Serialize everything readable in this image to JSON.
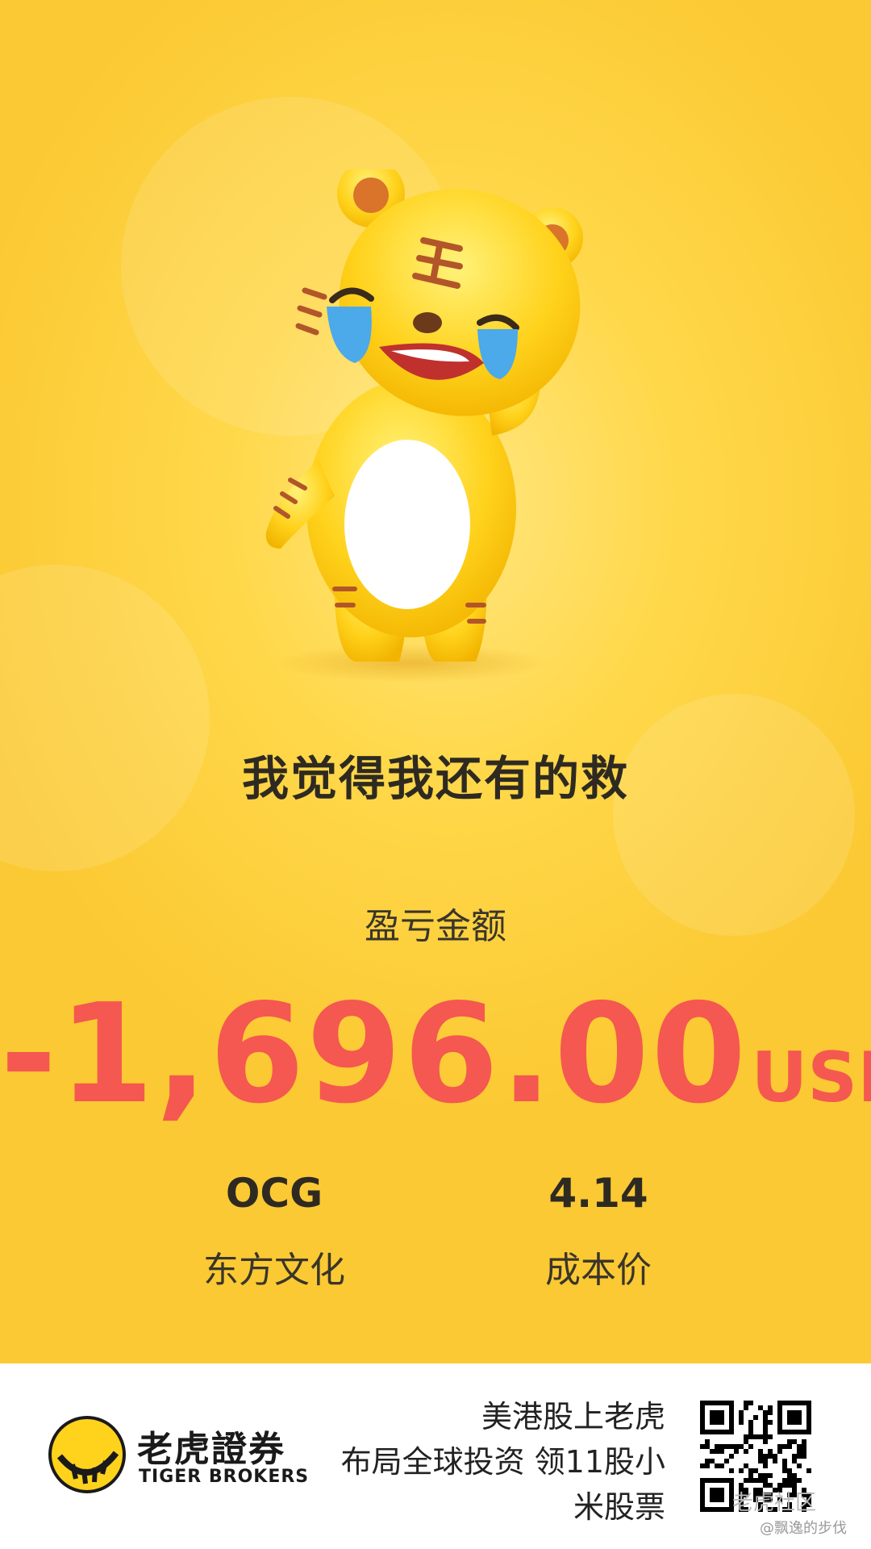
{
  "headline": "我觉得我还有的救",
  "pnl": {
    "label": "盈亏金额",
    "amount": "-1,696.00",
    "currency": "USD"
  },
  "stock": {
    "ticker": "OCG",
    "name": "东方文化"
  },
  "cost": {
    "value": "4.14",
    "label": "成本价"
  },
  "footer": {
    "brand_cn": "老虎證券",
    "brand_en": "TIGER BROKERS",
    "slogan_line1": "美港股上老虎",
    "slogan_line2": "布局全球投资 领11股小",
    "slogan_line3": "米股票",
    "watermark1": "老虎社区",
    "watermark2": "@飘逸的步伐"
  },
  "colors": {
    "background": "#fbc933",
    "loss": "#f45850",
    "text": "#2e2a22"
  },
  "icons": [
    "crying-tiger-mascot",
    "tiger-logo-icon",
    "qr-code"
  ]
}
